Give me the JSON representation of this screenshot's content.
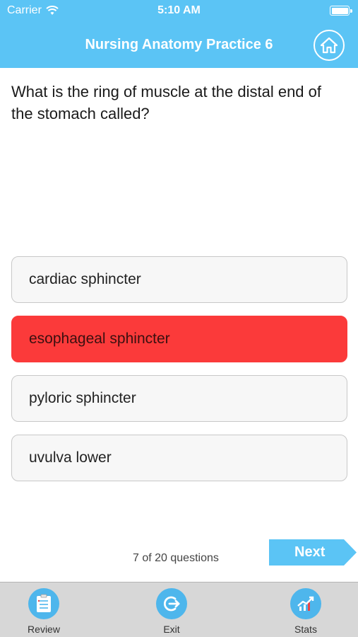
{
  "status_bar": {
    "carrier": "Carrier",
    "time": "5:10 AM"
  },
  "header": {
    "title": "Nursing Anatomy Practice 6",
    "home_icon": "home-icon"
  },
  "question": {
    "text": "What is the ring of muscle at the distal end of the stomach called?"
  },
  "answers": [
    {
      "label": "cardiac sphincter",
      "state": "default"
    },
    {
      "label": "esophageal sphincter",
      "state": "wrong"
    },
    {
      "label": "pyloric sphincter",
      "state": "default"
    },
    {
      "label": "uvulva lower",
      "state": "default"
    }
  ],
  "progress": {
    "text": "7 of 20 questions"
  },
  "next_button": {
    "label": "Next"
  },
  "tabs": [
    {
      "label": "Review",
      "icon": "review-icon"
    },
    {
      "label": "Exit",
      "icon": "exit-icon"
    },
    {
      "label": "Stats",
      "icon": "stats-icon"
    }
  ],
  "colors": {
    "header": "#5bc4f5",
    "wrong": "#fb3a3a",
    "tab_icon": "#4eb6ec",
    "tabbar": "#d7d7d7"
  }
}
